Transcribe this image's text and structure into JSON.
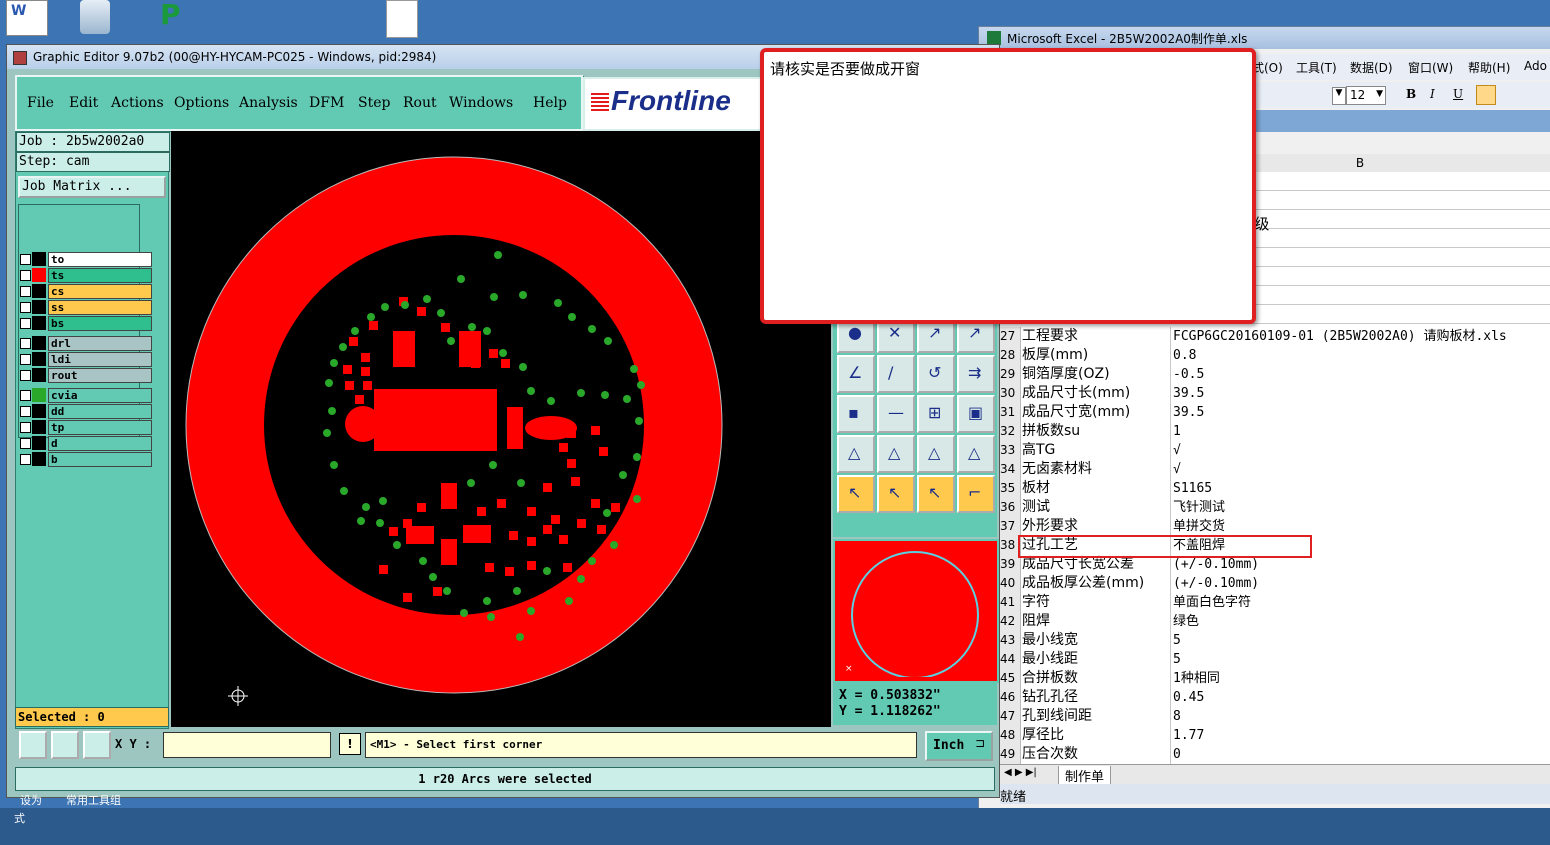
{
  "desktop": {
    "icon_labels": [
      "W",
      "",
      "",
      ""
    ],
    "bottom_texts": [
      "设为",
      "常用工具组",
      "式"
    ]
  },
  "excel": {
    "title": "Microsoft Excel - 2B5W2002A0制作单.xls",
    "menus": [
      "式(O)",
      "工具(T)",
      "数据(D)",
      "窗口(W)",
      "帮助(H)",
      "Ado"
    ],
    "font_size": "12",
    "format_buttons": [
      "B",
      "I",
      "U"
    ],
    "column_b_header": "B",
    "partial_row_text": "I级",
    "rows": [
      {
        "n": "27",
        "a": "工程要求",
        "b": "FCGP6GC20160109-01 (2B5W2002A0) 请购板材.xls"
      },
      {
        "n": "28",
        "a": "板厚(mm)",
        "b": "0.8"
      },
      {
        "n": "29",
        "a": "铜箔厚度(OZ)",
        "b": "-0.5"
      },
      {
        "n": "30",
        "a": "成品尺寸长(mm)",
        "b": "39.5"
      },
      {
        "n": "31",
        "a": "成品尺寸宽(mm)",
        "b": "39.5"
      },
      {
        "n": "32",
        "a": "拼板数su",
        "b": "1"
      },
      {
        "n": "33",
        "a": "高TG",
        "b": "√"
      },
      {
        "n": "34",
        "a": "无卤素材料",
        "b": "√"
      },
      {
        "n": "35",
        "a": "板材",
        "b": "S1165"
      },
      {
        "n": "36",
        "a": "测试",
        "b": "飞针测试"
      },
      {
        "n": "37",
        "a": "外形要求",
        "b": "单拼交货"
      },
      {
        "n": "38",
        "a": "过孔工艺",
        "b": "不盖阻焊"
      },
      {
        "n": "39",
        "a": "成品尺寸长宽公差",
        "b": "(+/-0.10mm)"
      },
      {
        "n": "40",
        "a": "成品板厚公差(mm)",
        "b": "(+/-0.10mm)"
      },
      {
        "n": "41",
        "a": "字符",
        "b": "单面白色字符"
      },
      {
        "n": "42",
        "a": "阻焊",
        "b": "绿色"
      },
      {
        "n": "43",
        "a": "最小线宽",
        "b": "5"
      },
      {
        "n": "44",
        "a": "最小线距",
        "b": "5"
      },
      {
        "n": "45",
        "a": "合拼板数",
        "b": "1种相同"
      },
      {
        "n": "46",
        "a": "钻孔孔径",
        "b": "0.45"
      },
      {
        "n": "47",
        "a": "孔到线间距",
        "b": "8"
      },
      {
        "n": "48",
        "a": "厚径比",
        "b": "1.77"
      },
      {
        "n": "49",
        "a": "压合次数",
        "b": "0"
      }
    ],
    "sheet_tab": "制作单",
    "status": "就绪"
  },
  "editor": {
    "title": "Graphic Editor 9.07b2 (00@HY-HYCAM-PC025 - Windows, pid:2984)",
    "menus": [
      "File",
      "Edit",
      "Actions",
      "Options",
      "Analysis",
      "DFM",
      "Step",
      "Rout",
      "Windows",
      "Help"
    ],
    "logo": "Frontline",
    "job": "Job : 2b5w2002a0",
    "step": "Step: cam",
    "job_matrix": "Job Matrix ...",
    "layers": [
      {
        "name": "to",
        "color": "#ffffff",
        "swatch": "#000000"
      },
      {
        "name": "ts",
        "color": "#2fbf8f",
        "swatch": "#ff0000"
      },
      {
        "name": "cs",
        "color": "#ffc94d",
        "swatch": "#000000"
      },
      {
        "name": "ss",
        "color": "#ffc94d",
        "swatch": "#000000"
      },
      {
        "name": "bs",
        "color": "#2fbf8f",
        "swatch": "#000000"
      },
      {
        "name": "drl",
        "color": "#a9c4c4",
        "swatch": "#000000"
      },
      {
        "name": "ldi",
        "color": "#a9c4c4",
        "swatch": "#000000"
      },
      {
        "name": "rout",
        "color": "#a9c4c4",
        "swatch": "#000000"
      },
      {
        "name": "cvia",
        "color": "#62c9b3",
        "swatch": "#2aa82a"
      },
      {
        "name": "dd",
        "color": "#62c9b3",
        "swatch": "#000000"
      },
      {
        "name": "tp",
        "color": "#62c9b3",
        "swatch": "#000000"
      },
      {
        "name": "d",
        "color": "#62c9b3",
        "swatch": "#000000"
      },
      {
        "name": "b",
        "color": "#62c9b3",
        "swatch": "#000000"
      }
    ],
    "selected": "Selected : 0",
    "coord_x": "X = 0.503832\"",
    "coord_y": "Y = 1.118262\"",
    "xy_label": "X Y :",
    "xy_value": "",
    "prompt": "<M1> - Select first corner",
    "units": "Inch",
    "status_message": "1 r20 Arcs were selected"
  },
  "popup": {
    "message": "请核实是否要做成开窗"
  },
  "colors": {
    "pad_red": "#ff0000",
    "via_green": "#2aa82a",
    "panel_teal": "#62c9b3",
    "highlight_red": "#e02020"
  }
}
